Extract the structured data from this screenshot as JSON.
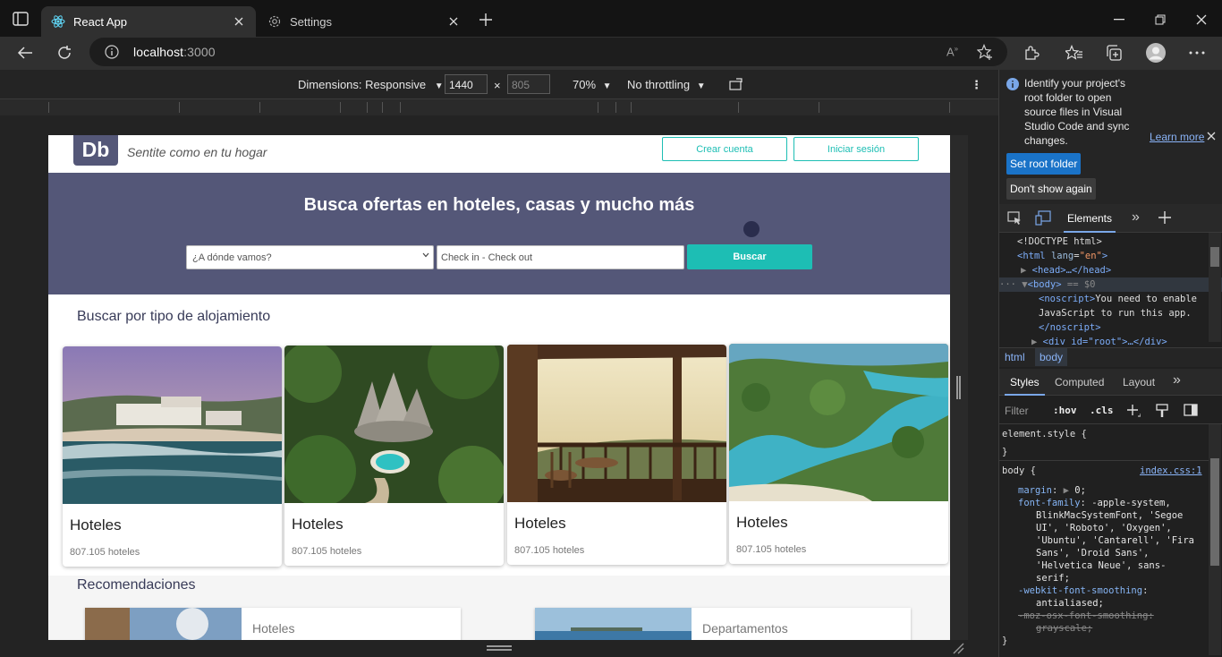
{
  "browser": {
    "tabs": [
      {
        "title": "React App",
        "icon": "react-icon",
        "active": true
      },
      {
        "title": "Settings",
        "icon": "gear-icon",
        "active": false
      }
    ],
    "address": {
      "host": "localhost",
      "port": ":3000"
    }
  },
  "device_toolbar": {
    "dimensions_label": "Dimensions: Responsive",
    "width": "1440",
    "height": "805",
    "times": "×",
    "zoom": "70%",
    "throttling": "No throttling"
  },
  "page": {
    "logo": "Db",
    "tagline": "Sentite como en tu hogar",
    "create_account": "Crear cuenta",
    "login": "Iniciar sesión",
    "hero_title": "Busca ofertas en hoteles, casas y mucho más",
    "destination_placeholder": "¿A dónde vamos?",
    "dates_placeholder": "Check in - Check out",
    "search_button": "Buscar",
    "section_types": "Buscar por tipo de alojamiento",
    "cards": [
      {
        "title": "Hoteles",
        "count": "807.105 hoteles"
      },
      {
        "title": "Hoteles",
        "count": "807.105 hoteles"
      },
      {
        "title": "Hoteles",
        "count": "807.105 hoteles"
      },
      {
        "title": "Hoteles",
        "count": "807.105 hoteles"
      }
    ],
    "section_recs": "Recomendaciones",
    "recs": [
      {
        "title": "Hoteles"
      },
      {
        "title": "Departamentos"
      }
    ]
  },
  "devtools": {
    "info_text": "Identify your project's root folder to open source files in Visual Studio Code and sync changes.",
    "learn_more": "Learn more",
    "set_root": "Set root folder",
    "dont_show": "Don't show again",
    "panel_elements": "Elements",
    "dom": {
      "doctype": "<!DOCTYPE html>",
      "html_open_tag": "<html",
      "html_attr": "lang",
      "html_val": "\"en\"",
      "head": "<head>…</head>",
      "body_tag": "<body>",
      "body_eq": "== $0",
      "noscript_open": "<noscript>",
      "noscript_text_1": "You need to enable",
      "noscript_text_2": "JavaScript to run this app.",
      "noscript_close": "</noscript>",
      "div_root": "<div id=\"root\">…</div>"
    },
    "breadcrumbs": [
      "html",
      "body"
    ],
    "subtabs": [
      "Styles",
      "Computed",
      "Layout"
    ],
    "filter_placeholder": "Filter",
    "hov": ":hov",
    "cls": ".cls",
    "css": {
      "element_style": "element.style {",
      "close": "}",
      "body_sel": "body {",
      "source": "index.css:1",
      "margin_prop": "margin",
      "margin_val": "0;",
      "ff_prop": "font-family",
      "ff_val_1": "-apple-system,",
      "ff_val_2": "BlinkMacSystemFont, 'Segoe",
      "ff_val_3": "UI', 'Roboto', 'Oxygen',",
      "ff_val_4": "'Ubuntu', 'Cantarell', 'Fira",
      "ff_val_5": "Sans', 'Droid Sans',",
      "ff_val_6": "'Helvetica Neue', sans-",
      "ff_val_7": "serif;",
      "wfs_prop": "-webkit-font-smoothing",
      "wfs_val": "antialiased;",
      "mfs_prop": "-moz-osx-font-smoothing:",
      "mfs_val": "grayscale;"
    }
  }
}
